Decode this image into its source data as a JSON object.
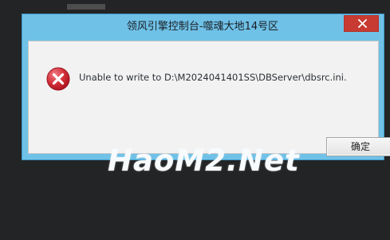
{
  "window": {
    "title": "领风引擎控制台-噬魂大地14号区"
  },
  "dialog": {
    "icon": "error-icon",
    "message": "Unable to write to D:\\M2024041401SS\\DBServer\\dbsrc.ini.",
    "ok_label": "确定"
  },
  "watermark": {
    "text": "HaoM2.Net"
  },
  "colors": {
    "title_bar": "#6fc1e7",
    "close_button": "#c73b32",
    "error_icon": "#c61f2b",
    "dialog_body": "#f2f2f2",
    "background": "#232425"
  }
}
